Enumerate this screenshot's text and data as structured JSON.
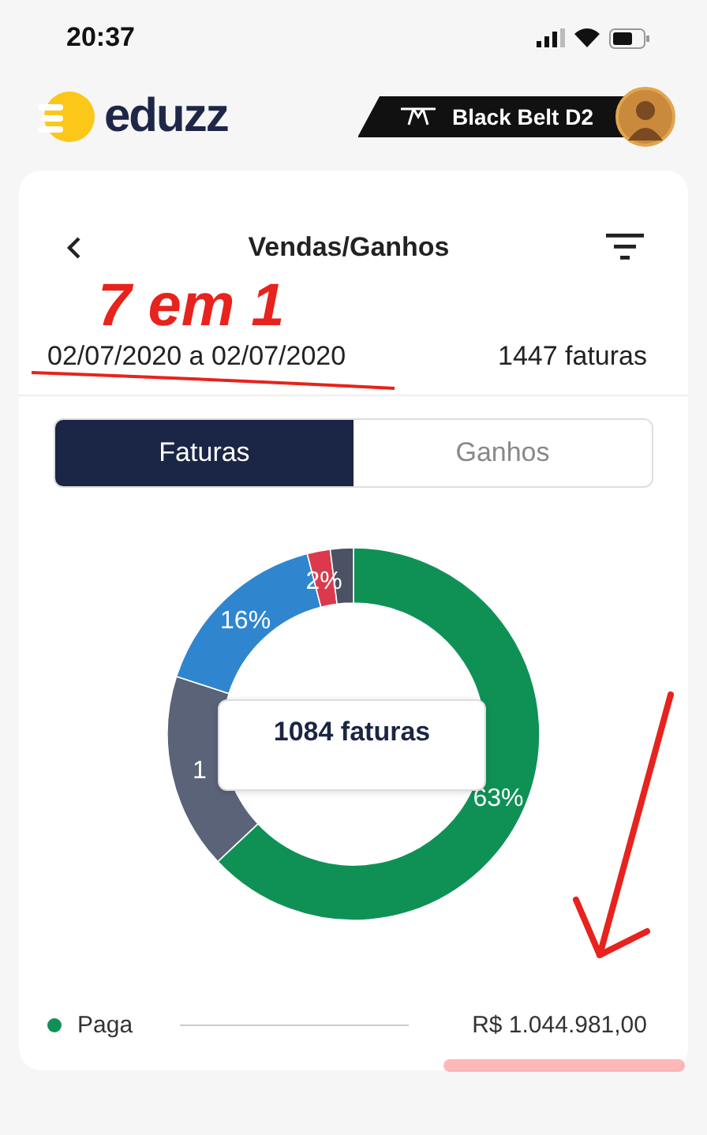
{
  "status_bar": {
    "time": "20:37"
  },
  "header": {
    "logo_text": "eduzz",
    "badge": "Black Belt D2"
  },
  "card": {
    "title": "Vendas/Ganhos",
    "date_range": "02/07/2020 a 02/07/2020",
    "count": "1447 faturas",
    "tabs": [
      {
        "label": "Faturas",
        "selected": true
      },
      {
        "label": "Ganhos",
        "selected": false
      }
    ],
    "chart_data": {
      "type": "donut",
      "values": [
        63,
        17,
        16,
        2,
        2
      ],
      "colors": [
        "#0f9156",
        "#5a6378",
        "#2f86cf",
        "#dc3a4c",
        "#4b5263"
      ],
      "value_labels": [
        "63%",
        null,
        "16%",
        "2%",
        null
      ]
    },
    "covered_label": "1",
    "tooltip": "1084 faturas",
    "legend": [
      {
        "label": "Paga",
        "value": "R$ 1.044.981,00",
        "color": "#0f9156"
      }
    ]
  },
  "annotation": {
    "text": "7 em 1"
  }
}
